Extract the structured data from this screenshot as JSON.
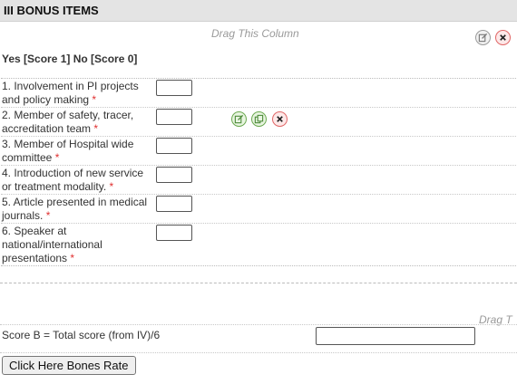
{
  "section": {
    "title": "III BONUS ITEMS"
  },
  "column": {
    "drag_hint": "Drag This Column",
    "drag_hint_right": "Drag T"
  },
  "scoring": {
    "legend": "Yes [Score 1] No [Score 0]"
  },
  "items": [
    {
      "label": "1. Involvement in PI projects and policy making",
      "required": "*"
    },
    {
      "label": "2. Member of safety, tracer, accreditation team",
      "required": "*"
    },
    {
      "label": "3. Member of Hospital wide committee",
      "required": "*"
    },
    {
      "label": "4. Introduction of new service or treatment modality.",
      "required": "*"
    },
    {
      "label": "5. Article presented in medical journals.",
      "required": "*"
    },
    {
      "label": "6. Speaker at national/international presentations",
      "required": "*"
    }
  ],
  "score_b": {
    "label": "Score B = Total score (from IV)/6",
    "value": ""
  },
  "button": {
    "label": "Click Here Bones Rate"
  },
  "icons": {
    "edit": "edit-icon",
    "close": "close-icon",
    "copy": "copy-icon"
  },
  "colors": {
    "header_bg": "#e4e4e4",
    "required": "#e03030",
    "green_icon": "#6aa84f",
    "red_icon": "#e06666"
  }
}
